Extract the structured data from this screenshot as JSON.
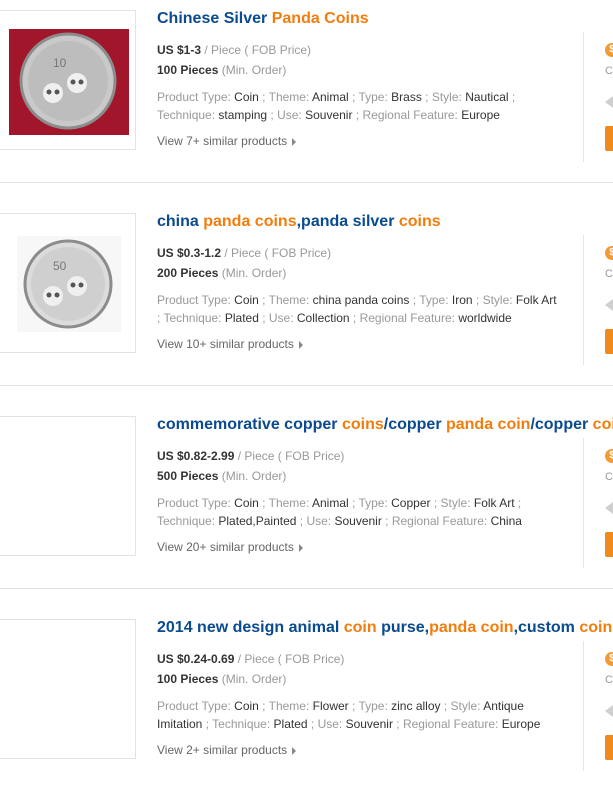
{
  "items": [
    {
      "title": [
        {
          "t": "Chinese Silver ",
          "hl": false
        },
        {
          "t": "Panda Coins",
          "hl": true
        }
      ],
      "price": "US $1-3",
      "price_unit": " / Piece ( FOB Price)",
      "moq": "100 Pieces",
      "moq_label": " (Min. Order)",
      "attrs": [
        {
          "k": "Product Type: ",
          "v": "Coin"
        },
        {
          "k": " ; Theme: ",
          "v": "Animal"
        },
        {
          "k": " ; Type: ",
          "v": "Brass"
        },
        {
          "k": " ; Style: ",
          "v": "Nautical"
        },
        {
          "k": " ; ",
          "v": ""
        },
        {
          "k": "Technique: ",
          "v": "stamping"
        },
        {
          "k": " ; Use: ",
          "v": "Souvenir"
        },
        {
          "k": " ; Regional Feature: ",
          "v": "Europe"
        }
      ],
      "similar": "View 7+ similar products",
      "image": {
        "kind": "coin-red",
        "label": "10"
      }
    },
    {
      "title": [
        {
          "t": "china ",
          "hl": false
        },
        {
          "t": "panda coins",
          "hl": true
        },
        {
          "t": ",panda silver ",
          "hl": false
        },
        {
          "t": "coins",
          "hl": true
        }
      ],
      "price": "US $0.3-1.2",
      "price_unit": " / Piece ( FOB Price)",
      "moq": "200 Pieces",
      "moq_label": " (Min. Order)",
      "attrs": [
        {
          "k": "Product Type: ",
          "v": "Coin"
        },
        {
          "k": " ; Theme: ",
          "v": "china panda coins"
        },
        {
          "k": " ; Type: ",
          "v": "Iron"
        },
        {
          "k": " ; Style: ",
          "v": "Folk Art"
        },
        {
          "k": " ; ",
          "v": ""
        },
        {
          "k": "Technique: ",
          "v": "Plated"
        },
        {
          "k": " ; Use: ",
          "v": "Collection"
        },
        {
          "k": " ; Regional Feature: ",
          "v": "worldwide"
        }
      ],
      "similar": "View 10+ similar products",
      "image": {
        "kind": "coin-white",
        "label": "50"
      }
    },
    {
      "title": [
        {
          "t": "commemorative copper ",
          "hl": false
        },
        {
          "t": "coins",
          "hl": true
        },
        {
          "t": "/copper ",
          "hl": false
        },
        {
          "t": "panda coin",
          "hl": true
        },
        {
          "t": "/copper ",
          "hl": false
        },
        {
          "t": "coins",
          "hl": true
        }
      ],
      "price": "US $0.82-2.99",
      "price_unit": " / Piece ( FOB Price)",
      "moq": "500 Pieces",
      "moq_label": " (Min. Order)",
      "attrs": [
        {
          "k": "Product Type: ",
          "v": "Coin"
        },
        {
          "k": " ; Theme: ",
          "v": "Animal"
        },
        {
          "k": " ; Type: ",
          "v": "Copper"
        },
        {
          "k": " ; Style: ",
          "v": "Folk Art"
        },
        {
          "k": " ; ",
          "v": ""
        },
        {
          "k": "Technique: ",
          "v": "Plated,Painted"
        },
        {
          "k": " ; Use: ",
          "v": "Souvenir"
        },
        {
          "k": " ; Regional Feature: ",
          "v": "China"
        }
      ],
      "similar": "View 20+ similar products",
      "image": {
        "kind": "blank",
        "label": ""
      }
    },
    {
      "title": [
        {
          "t": "2014 new design animal ",
          "hl": false
        },
        {
          "t": "coin",
          "hl": true
        },
        {
          "t": " purse,",
          "hl": false
        },
        {
          "t": "panda coin",
          "hl": true
        },
        {
          "t": ",custom ",
          "hl": false
        },
        {
          "t": "coin",
          "hl": true
        }
      ],
      "price": "US $0.24-0.69",
      "price_unit": " / Piece ( FOB Price)",
      "moq": "100 Pieces",
      "moq_label": " (Min. Order)",
      "attrs": [
        {
          "k": "Product Type: ",
          "v": "Coin"
        },
        {
          "k": " ; Theme: ",
          "v": "Flower"
        },
        {
          "k": " ; Type: ",
          "v": "zinc alloy"
        },
        {
          "k": " ; Style: ",
          "v": "Antique"
        },
        {
          "k": " ",
          "v": "Imitation"
        },
        {
          "k": " ; Technique: ",
          "v": "Plated"
        },
        {
          "k": " ; Use: ",
          "v": "Souvenir"
        },
        {
          "k": " ; Regional Feature: ",
          "v": "Europe"
        }
      ],
      "similar": "View 2+ similar products",
      "image": {
        "kind": "blank",
        "label": ""
      }
    }
  ],
  "right_column": {
    "coin_glyph": "$",
    "text": "C"
  },
  "colors": {
    "title": "#0a4a8f",
    "highlight": "#f27d0c",
    "button": "#f08a1a"
  }
}
